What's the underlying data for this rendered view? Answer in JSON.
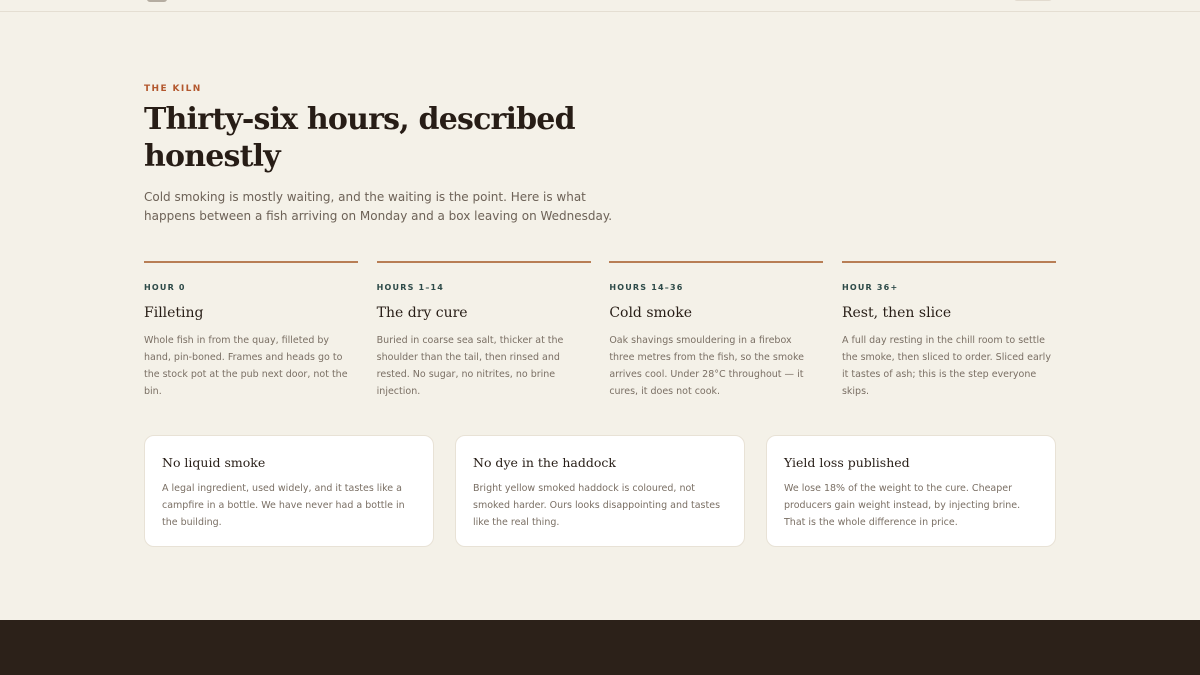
{
  "colors": {
    "background": "#f4f1e8",
    "accent": "#b3582e",
    "rule": "#b87e55",
    "step_label": "#2d4a48",
    "heading": "#271d16",
    "body_text": "#7a6f64",
    "footer": "#2c2119"
  },
  "section": {
    "eyebrow": "THE KILN",
    "title": "Thirty-six hours, described honestly",
    "intro": "Cold smoking is mostly waiting, and the waiting is the point. Here is what happens between a fish arriving on Monday and a box leaving on Wednesday."
  },
  "steps": [
    {
      "label": "HOUR 0",
      "title": "Filleting",
      "body": "Whole fish in from the quay, filleted by hand, pin-boned. Frames and heads go to the stock pot at the pub next door, not the bin."
    },
    {
      "label": "HOURS 1–14",
      "title": "The dry cure",
      "body": "Buried in coarse sea salt, thicker at the shoulder than the tail, then rinsed and rested. No sugar, no nitrites, no brine injection."
    },
    {
      "label": "HOURS 14–36",
      "title": "Cold smoke",
      "body": "Oak shavings smouldering in a firebox three metres from the fish, so the smoke arrives cool. Under 28°C throughout — it cures, it does not cook."
    },
    {
      "label": "HOUR 36+",
      "title": "Rest, then slice",
      "body": "A full day resting in the chill room to settle the smoke, then sliced to order. Sliced early it tastes of ash; this is the step everyone skips."
    }
  ],
  "cards": [
    {
      "title": "No liquid smoke",
      "body": "A legal ingredient, used widely, and it tastes like a campfire in a bottle. We have never had a bottle in the building."
    },
    {
      "title": "No dye in the haddock",
      "body": "Bright yellow smoked haddock is coloured, not smoked harder. Ours looks disappointing and tastes like the real thing."
    },
    {
      "title": "Yield loss published",
      "body": "We lose 18% of the weight to the cure. Cheaper producers gain weight instead, by injecting brine. That is the whole difference in price."
    }
  ]
}
